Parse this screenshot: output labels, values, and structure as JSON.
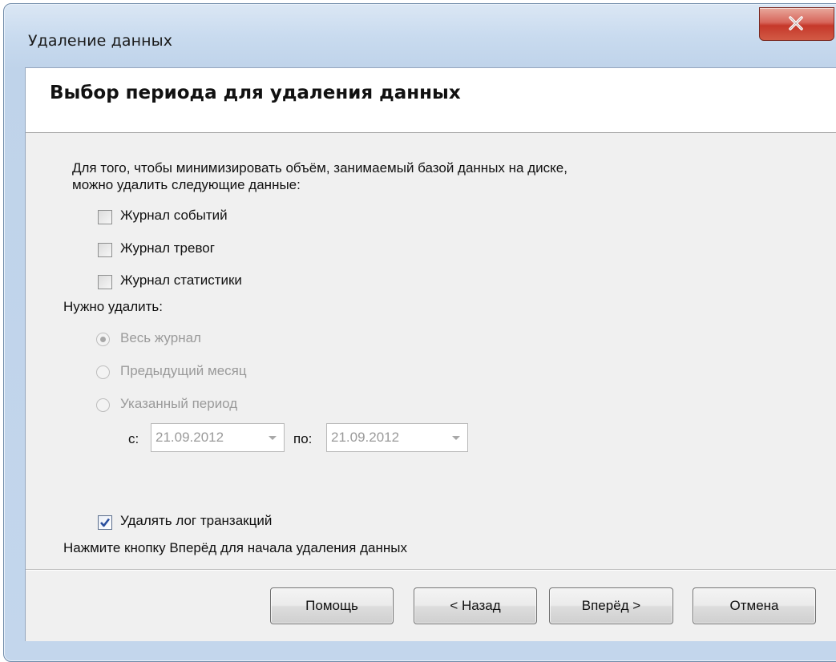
{
  "window": {
    "title": "Удаление данных"
  },
  "header": {
    "title": "Выбор периода для удаления данных"
  },
  "intro": {
    "line1": "Для того, чтобы минимизировать объём, занимаемый базой данных на диске,",
    "line2": "можно удалить следующие данные:"
  },
  "logs": [
    {
      "label": "Журнал событий",
      "checked": false
    },
    {
      "label": "Журнал тревог",
      "checked": false
    },
    {
      "label": "Журнал статистики",
      "checked": false
    }
  ],
  "delete_label": "Нужно удалить:",
  "period_options": [
    {
      "label": "Весь журнал",
      "selected": true
    },
    {
      "label": "Предыдущий месяц",
      "selected": false
    },
    {
      "label": "Указанный период",
      "selected": false
    }
  ],
  "range": {
    "from_label": "с:",
    "from_value": "21.09.2012",
    "to_label": "по:",
    "to_value": "21.09.2012"
  },
  "transaction_log": {
    "label": "Удалять лог транзакций",
    "checked": true
  },
  "hint": "Нажмите кнопку Вперёд для начала удаления данных",
  "buttons": {
    "help": "Помощь",
    "back": "< Назад",
    "next": "Вперёд >",
    "cancel": "Отмена"
  },
  "icons": {
    "close": "close-icon",
    "checkmark": "checkmark-icon",
    "dropdown": "chevron-down-icon"
  }
}
